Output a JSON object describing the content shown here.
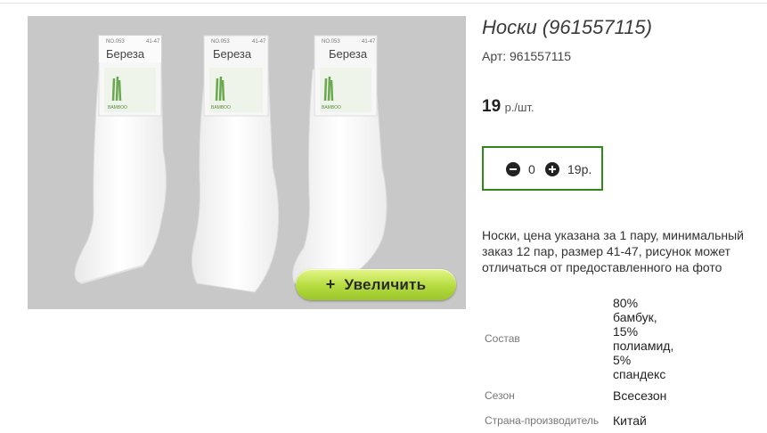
{
  "product": {
    "title": "Носки (961557115)",
    "article": "Арт: 961557115",
    "price_value": "19",
    "price_unit": "р./шт.",
    "zoom_label": "Увеличить",
    "zoom_icon": "plus-icon",
    "package_brand": "Береза",
    "package_code": "NO.053",
    "package_size": "41-47",
    "package_logo": "BAMBOO"
  },
  "cart": {
    "quantity": "0",
    "sum": "19р."
  },
  "description": "Носки, цена указана за 1 пару, минимальный заказ 12 пар, размер 41-47, рисунок может отличаться от предоставленного на фото",
  "properties": {
    "composition_label": "Состав",
    "composition_lines": [
      "80%",
      "бамбук,",
      "15%",
      "полиамид,",
      "5%",
      "спандекс"
    ],
    "season_label": "Сезон",
    "season_value": "Всесезон",
    "country_label": "Страна-производитель",
    "country_value": "Китай"
  },
  "colors": {
    "accent_border": "#2f8a1a",
    "zoom_button": "#b4db3e"
  }
}
